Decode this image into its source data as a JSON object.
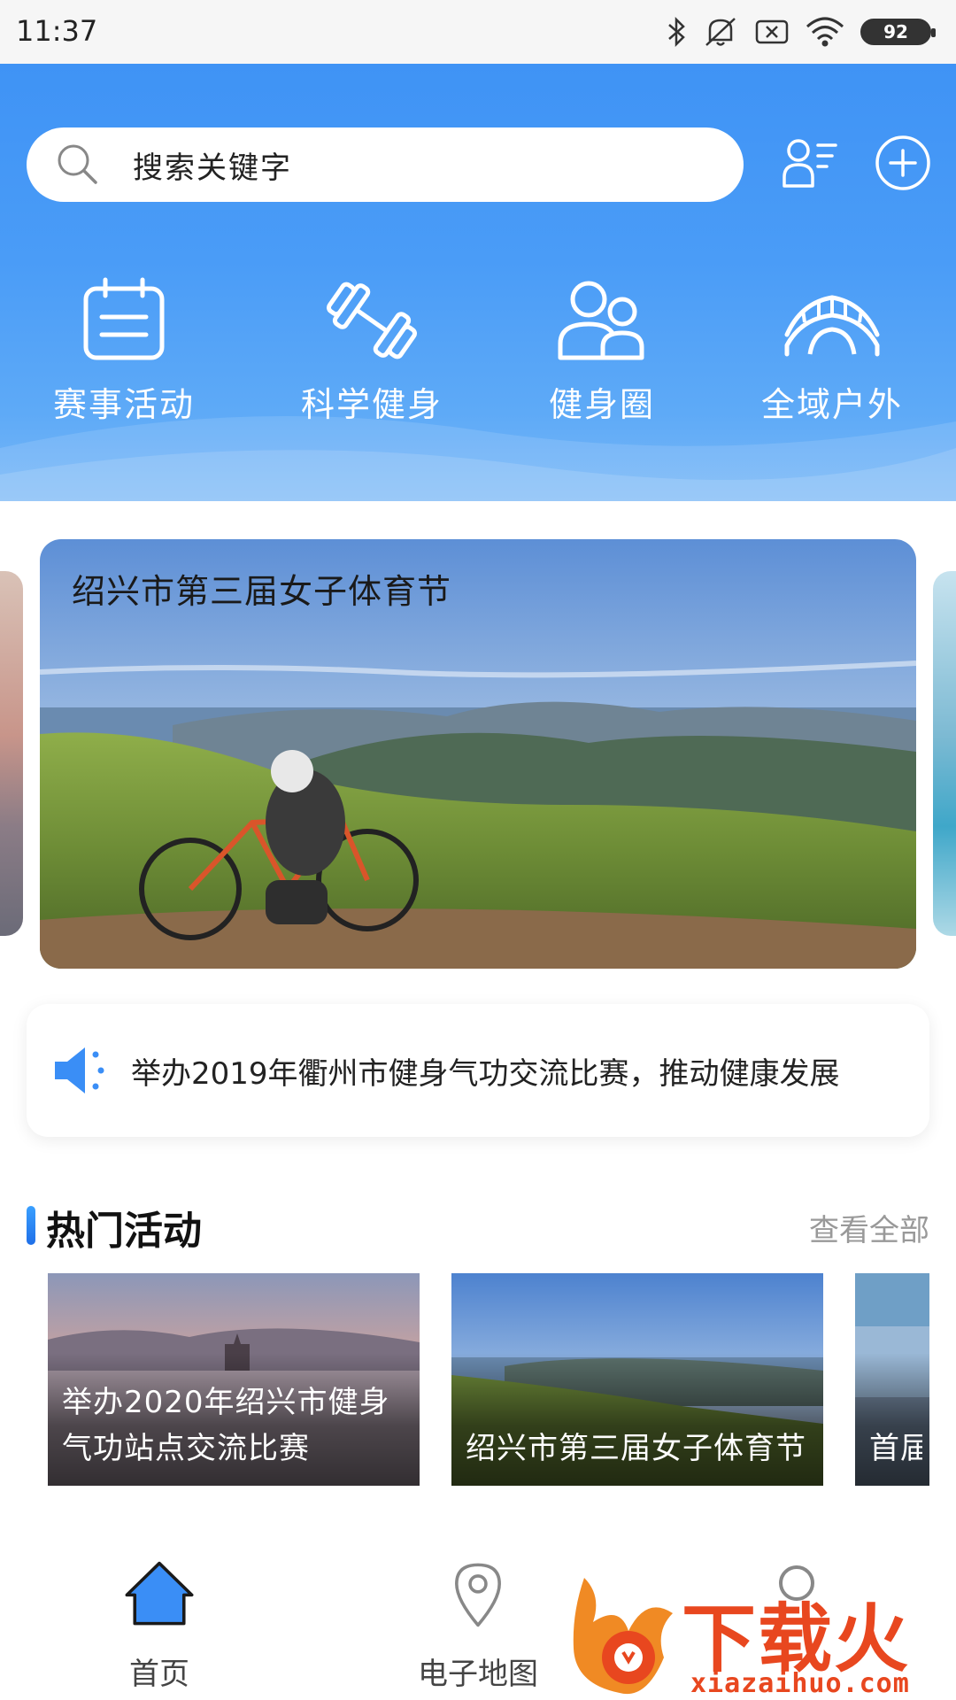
{
  "status_bar": {
    "time": "11:37",
    "battery": "92",
    "icons": [
      "bluetooth-icon",
      "mute-icon",
      "sim-error-icon",
      "wifi-icon",
      "battery-icon"
    ]
  },
  "header": {
    "search": {
      "placeholder": "搜索关键字"
    },
    "actions": [
      "user-list-icon",
      "add-circle-icon"
    ],
    "colors": {
      "gradient_top": "#3f93f5",
      "gradient_bottom": "#7ab8f6"
    }
  },
  "quick_nav": [
    {
      "label": "赛事活动",
      "icon": "calendar-icon"
    },
    {
      "label": "科学健身",
      "icon": "dumbbell-icon"
    },
    {
      "label": "健身圈",
      "icon": "users-icon"
    },
    {
      "label": "全域户外",
      "icon": "bridge-icon"
    }
  ],
  "banner": {
    "title": "绍兴市第三届女子体育节"
  },
  "notice": {
    "text": "举办2019年衢州市健身气功交流比赛，推动健康发展",
    "icon": "speaker-icon"
  },
  "hot_section": {
    "title": "热门活动",
    "view_all": "查看全部",
    "items": [
      {
        "title": "举办2020年绍兴市健身气功站点交流比赛"
      },
      {
        "title": "绍兴市第三届女子体育节"
      },
      {
        "title": "首届会杯"
      }
    ]
  },
  "tab_bar": [
    {
      "label": "首页",
      "icon": "home-icon",
      "active": true
    },
    {
      "label": "电子地图",
      "icon": "location-pin-icon",
      "active": false
    },
    {
      "label": "",
      "icon": "profile-icon",
      "active": false
    }
  ],
  "watermark": {
    "text": "下载火",
    "url": "xiazaihuo.com"
  },
  "accent_color": "#3a8ef6"
}
